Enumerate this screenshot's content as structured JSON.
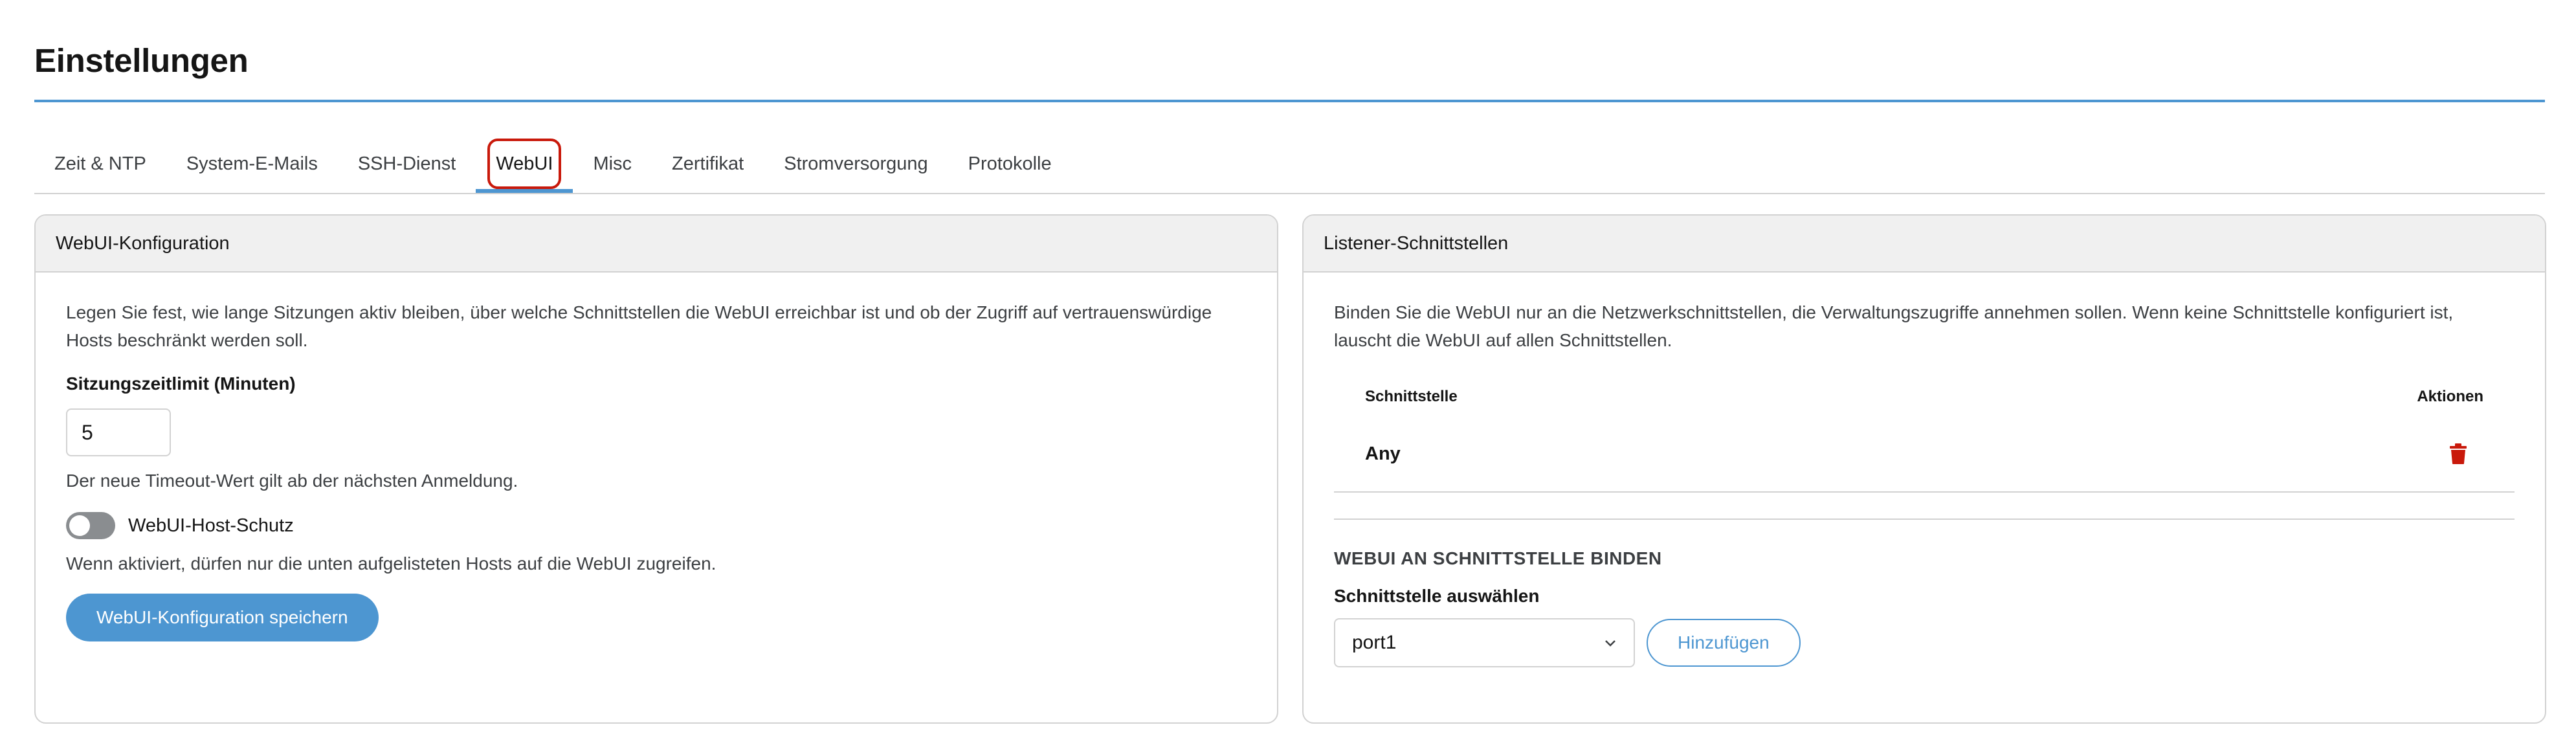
{
  "page": {
    "title": "Einstellungen"
  },
  "tabs": [
    {
      "label": "Zeit & NTP"
    },
    {
      "label": "System-E-Mails"
    },
    {
      "label": "SSH-Dienst"
    },
    {
      "label": "WebUI",
      "active": true
    },
    {
      "label": "Misc"
    },
    {
      "label": "Zertifikat"
    },
    {
      "label": "Stromversorgung"
    },
    {
      "label": "Protokolle"
    }
  ],
  "webui_config": {
    "header": "WebUI-Konfiguration",
    "description": "Legen Sie fest, wie lange Sitzungen aktiv bleiben, über welche Schnittstellen die WebUI erreichbar ist und ob der Zugriff auf vertrauenswürdige Hosts beschränkt werden soll.",
    "timeout_label": "Sitzungszeitlimit (Minuten)",
    "timeout_value": "5",
    "timeout_helper": "Der neue Timeout-Wert gilt ab der nächsten Anmeldung.",
    "host_protection_label": "WebUI-Host-Schutz",
    "host_protection_enabled": false,
    "host_protection_helper": "Wenn aktiviert, dürfen nur die unten aufgelisteten Hosts auf die WebUI zugreifen.",
    "save_button": "WebUI-Konfiguration speichern"
  },
  "listener": {
    "header": "Listener-Schnittstellen",
    "description": "Binden Sie die WebUI nur an die Netzwerkschnittstellen, die Verwaltungszugriffe annehmen sollen. Wenn keine Schnittstelle konfiguriert ist, lauscht die WebUI auf allen Schnittstellen.",
    "columns": {
      "interface": "Schnittstelle",
      "actions": "Aktionen"
    },
    "rows": [
      {
        "interface": "Any"
      }
    ],
    "bind_section_title": "WEBUI AN SCHNITTSTELLE BINDEN",
    "select_label": "Schnittstelle auswählen",
    "select_value": "port1",
    "add_button": "Hinzufügen"
  },
  "colors": {
    "accent": "#4d96d1",
    "focus_ring": "#c9190b",
    "delete_icon": "#c9190b"
  }
}
